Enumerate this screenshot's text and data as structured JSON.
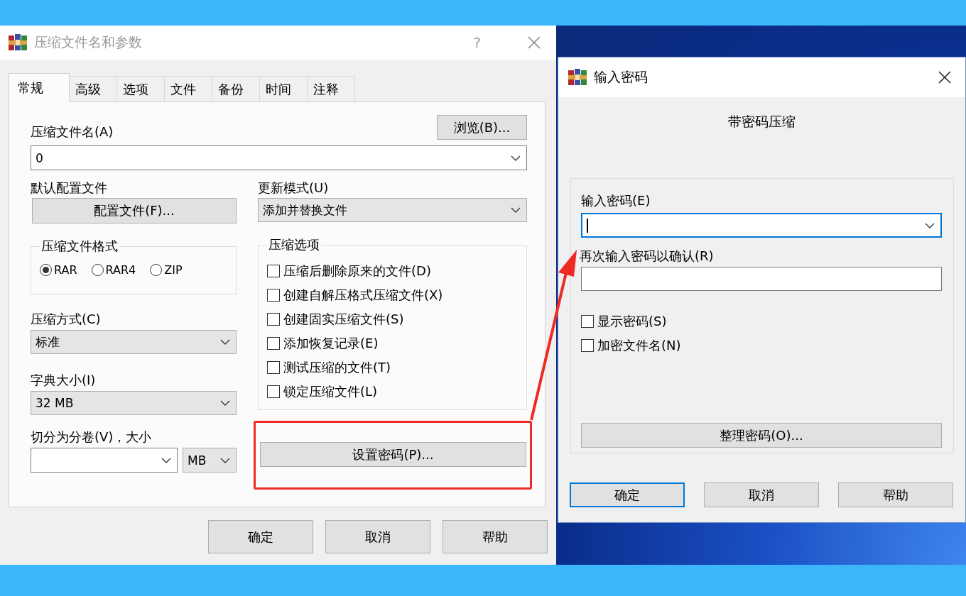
{
  "main_dialog": {
    "title": "压缩文件名和参数",
    "help": "?",
    "tabs": [
      {
        "label": "常规",
        "selected": true
      },
      {
        "label": "高级",
        "selected": false
      },
      {
        "label": "选项",
        "selected": false
      },
      {
        "label": "文件",
        "selected": false
      },
      {
        "label": "备份",
        "selected": false
      },
      {
        "label": "时间",
        "selected": false
      },
      {
        "label": "注释",
        "selected": false
      }
    ],
    "archive_name": {
      "label": "压缩文件名(A)",
      "browse": "浏览(B)...",
      "value": "0"
    },
    "profile": {
      "label": "默认配置文件",
      "button": "配置文件(F)..."
    },
    "update_mode": {
      "label": "更新模式(U)",
      "value": "添加并替换文件"
    },
    "format": {
      "legend": "压缩文件格式",
      "options": [
        {
          "label": "RAR",
          "selected": true
        },
        {
          "label": "RAR4",
          "selected": false
        },
        {
          "label": "ZIP",
          "selected": false
        }
      ]
    },
    "method": {
      "label": "压缩方式(C)",
      "value": "标准"
    },
    "dictionary": {
      "label": "字典大小(I)",
      "value": "32 MB"
    },
    "volumes": {
      "label": "切分为分卷(V)，大小",
      "unit": "MB"
    },
    "options": {
      "legend": "压缩选项",
      "items": [
        {
          "label": "压缩后删除原来的文件(D)",
          "checked": false
        },
        {
          "label": "创建自解压格式压缩文件(X)",
          "checked": false
        },
        {
          "label": "创建固实压缩文件(S)",
          "checked": false
        },
        {
          "label": "添加恢复记录(E)",
          "checked": false
        },
        {
          "label": "测试压缩的文件(T)",
          "checked": false
        },
        {
          "label": "锁定压缩文件(L)",
          "checked": false
        }
      ]
    },
    "password_button": {
      "label": "设置密码(P)...",
      "highlighted": true
    },
    "buttons": [
      "确定",
      "取消",
      "帮助"
    ]
  },
  "password_dialog": {
    "title": "输入密码",
    "heading": "带密码压缩",
    "password": {
      "label": "输入密码(E)",
      "focused": true
    },
    "confirm": {
      "label": "再次输入密码以确认(R)",
      "focused": false
    },
    "options": [
      {
        "label": "显示密码(S)",
        "checked": false
      },
      {
        "label": "加密文件名(N)",
        "checked": false
      }
    ],
    "organize": "整理密码(O)...",
    "buttons": [
      {
        "label": "确定",
        "default": true
      },
      {
        "label": "取消",
        "default": false
      },
      {
        "label": "帮助",
        "default": false
      }
    ]
  }
}
